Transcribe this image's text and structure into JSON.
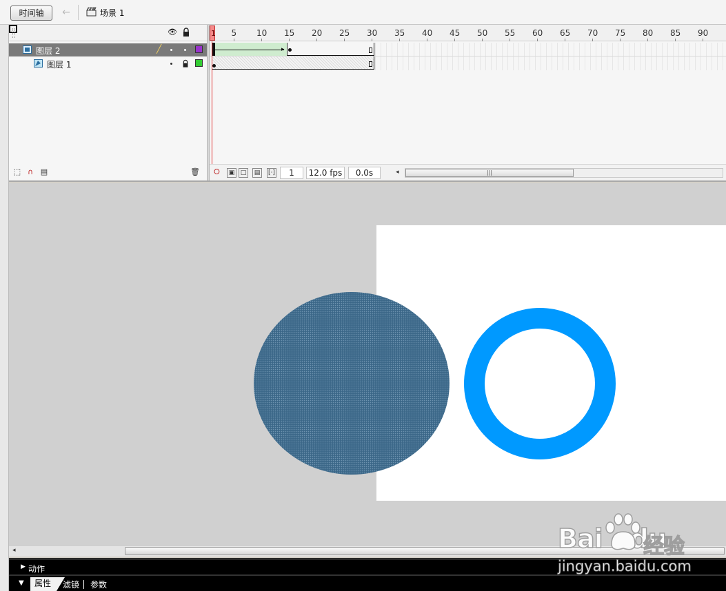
{
  "toolbar": {
    "timeline_button": "时间轴",
    "scene_label": "场景 1"
  },
  "timeline": {
    "ruler_labels": [
      "1",
      "5",
      "10",
      "15",
      "20",
      "25",
      "30",
      "35",
      "40",
      "45",
      "50",
      "55",
      "60",
      "65",
      "70",
      "75",
      "80",
      "85",
      "90"
    ],
    "layers": [
      {
        "name": "图层 2",
        "selected": true,
        "color": "#9933cc"
      },
      {
        "name": "图层 1",
        "selected": false,
        "color": "#33cc33",
        "locked": true
      }
    ],
    "footer": {
      "current_frame": "1",
      "fps": "12.0 fps",
      "elapsed": "0.0s"
    }
  },
  "stage": {
    "canvas_color": "#ffffff",
    "filled_circle_color": "#3c6889",
    "ring_color": "#0099ff"
  },
  "panels": {
    "actions_label": "动作",
    "tabs": [
      "属性",
      "滤镜",
      "参数"
    ]
  },
  "watermark": {
    "brand_left": "Bai",
    "brand_right": "du",
    "product": "经验",
    "url": "jingyan.baidu.com"
  }
}
